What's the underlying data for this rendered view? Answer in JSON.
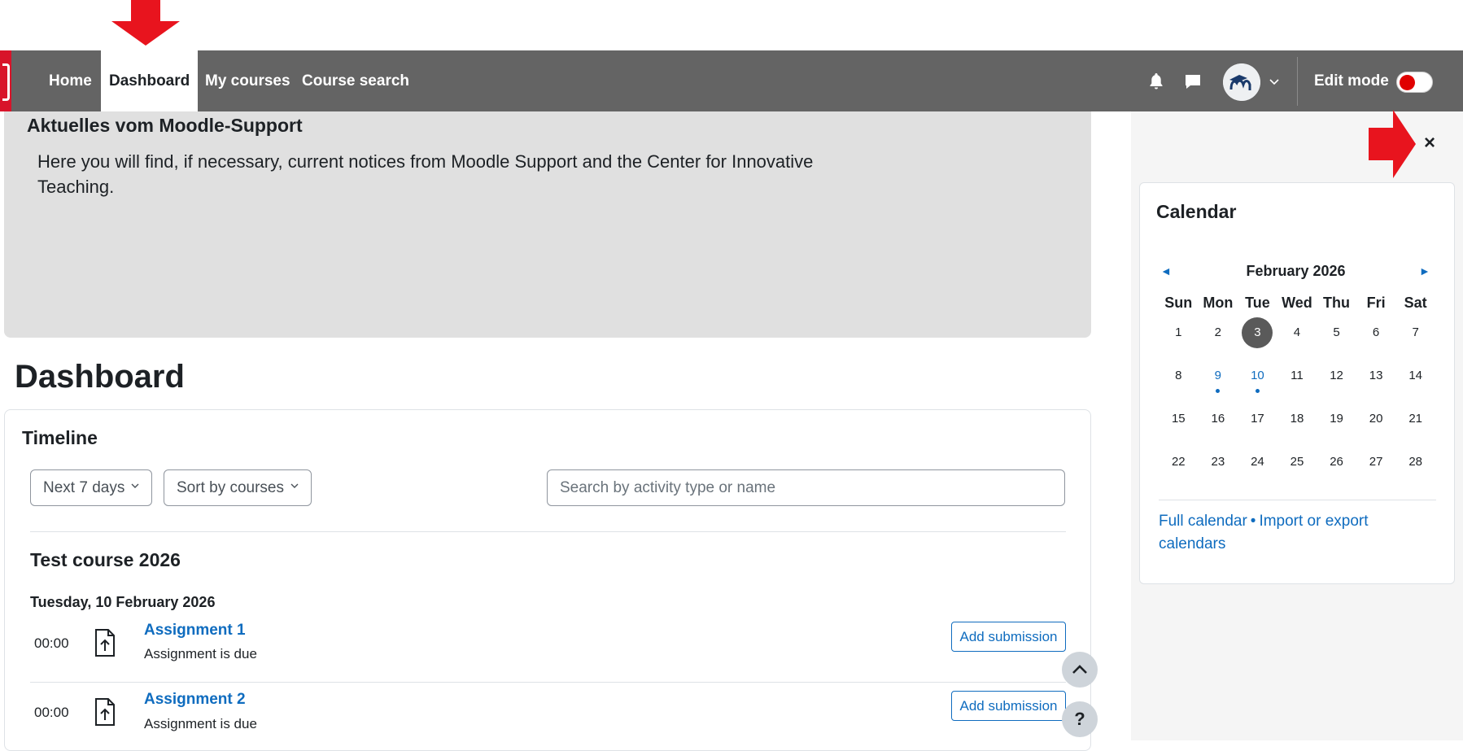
{
  "nav": {
    "items": [
      {
        "label": "Home"
      },
      {
        "label": "Dashboard"
      },
      {
        "label": "My courses"
      },
      {
        "label": "Course search"
      }
    ],
    "edit_mode_label": "Edit mode",
    "edit_mode_on": false
  },
  "notice": {
    "title": "Aktuelles vom Moodle-Support",
    "text": "Here you will find, if necessary, current notices from Moodle Support and the Center for Innovative Teaching."
  },
  "page_title": "Dashboard",
  "timeline": {
    "title": "Timeline",
    "filter_label": "Next 7 days",
    "sort_label": "Sort by courses",
    "search_placeholder": "Search by activity type or name",
    "course_title": "Test course 2026",
    "date_heading": "Tuesday, 10 February 2026",
    "events": [
      {
        "time": "00:00",
        "name": "Assignment 1",
        "subtitle": "Assignment is due",
        "action": "Add submission"
      },
      {
        "time": "00:00",
        "name": "Assignment 2",
        "subtitle": "Assignment is due",
        "action": "Add submission"
      }
    ]
  },
  "floating": {
    "up_icon": "chevron-up-icon",
    "help": "?"
  },
  "drawer": {
    "close": "×"
  },
  "calendar": {
    "title": "Calendar",
    "month": "February 2026",
    "prev": "◄",
    "next": "►",
    "weekdays": [
      "Sun",
      "Mon",
      "Tue",
      "Wed",
      "Thu",
      "Fri",
      "Sat"
    ],
    "weeks": [
      [
        "1",
        "2",
        "3",
        "4",
        "5",
        "6",
        "7"
      ],
      [
        "8",
        "9",
        "10",
        "11",
        "12",
        "13",
        "14"
      ],
      [
        "15",
        "16",
        "17",
        "18",
        "19",
        "20",
        "21"
      ],
      [
        "22",
        "23",
        "24",
        "25",
        "26",
        "27",
        "28"
      ]
    ],
    "today": "3",
    "event_days": [
      "9",
      "10"
    ],
    "link_full": "Full calendar",
    "link_sep": "•",
    "link_import": "Import or export calendars"
  },
  "colors": {
    "navbar": "#646464",
    "link": "#0f6cbf",
    "annotation_arrow": "#e8141e"
  }
}
